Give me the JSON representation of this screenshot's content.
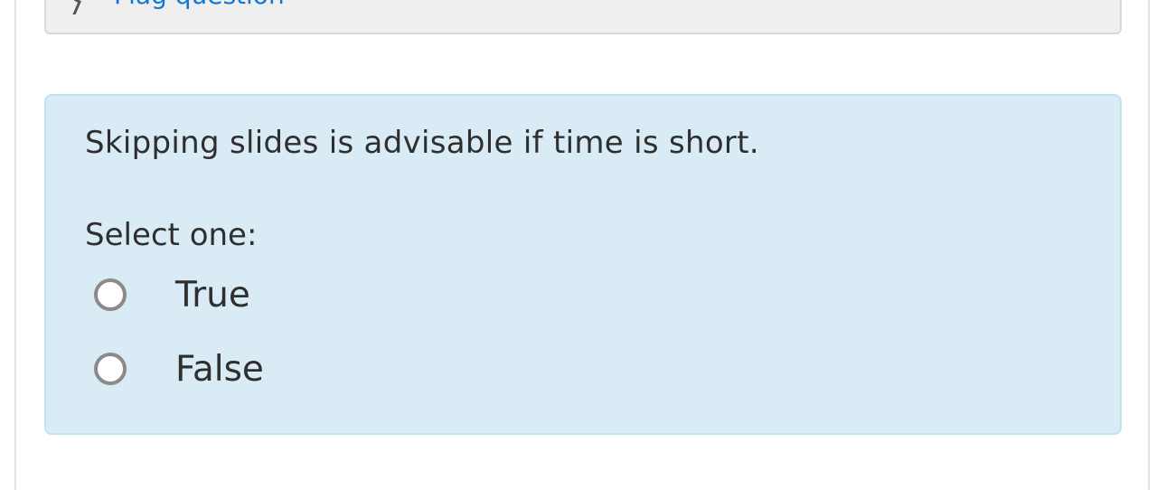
{
  "info": {
    "flag_label": "Flag question",
    "link_color": "#1177d1"
  },
  "question": {
    "text": "Skipping slides is advisable if time is short.",
    "prompt": "Select one:",
    "options": [
      {
        "label": "True",
        "selected": false
      },
      {
        "label": "False",
        "selected": false
      }
    ],
    "background_color": "#d9ecf5",
    "border_color": "#bde5f1"
  },
  "icons": {
    "flag": "flag-icon",
    "radio": "radio-button"
  }
}
